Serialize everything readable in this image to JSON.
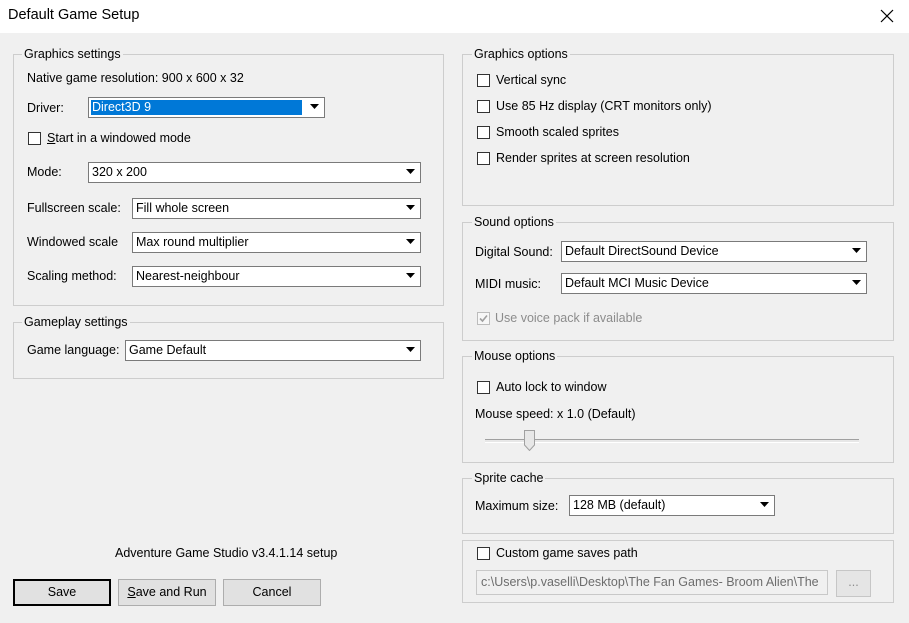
{
  "window": {
    "title": "Default Game Setup"
  },
  "graphics_settings": {
    "legend": "Graphics settings",
    "native_resolution": "Native game resolution: 900 x 600 x 32",
    "driver_label": "Driver:",
    "driver_value": "Direct3D 9",
    "windowed_label_s": "S",
    "windowed_label_rest": "tart in a windowed mode",
    "windowed_checked": false,
    "mode_label": "Mode:",
    "mode_value": "320 x 200",
    "fullscreen_scale_label": "Fullscreen scale:",
    "fullscreen_scale_value": "Fill whole screen",
    "windowed_scale_label": "Windowed scale",
    "windowed_scale_value": "Max round multiplier",
    "scaling_method_label": "Scaling method:",
    "scaling_method_value": "Nearest-neighbour"
  },
  "gameplay_settings": {
    "legend": "Gameplay settings",
    "language_label": "Game language:",
    "language_value": "Game Default"
  },
  "footer": {
    "version_text": "Adventure Game Studio v3.4.1.14 setup",
    "save_label": "Save",
    "save_run_prefix": "",
    "save_run_u": "S",
    "save_run_rest": "ave and Run",
    "cancel_label": "Cancel"
  },
  "graphics_options": {
    "legend": "Graphics options",
    "vsync_label": "Vertical sync",
    "hz85_label": "Use 85 Hz display (CRT monitors only)",
    "smooth_label": "Smooth scaled sprites",
    "render_label": "Render sprites at screen resolution"
  },
  "sound_options": {
    "legend": "Sound options",
    "digital_label": "Digital Sound:",
    "digital_value": "Default DirectSound Device",
    "midi_label": "MIDI music:",
    "midi_value": "Default MCI Music Device",
    "voice_label": "Use voice pack if available",
    "voice_checked": true
  },
  "mouse_options": {
    "legend": "Mouse options",
    "autolock_label": "Auto lock to window",
    "speed_label": "Mouse speed: x 1.0 (Default)",
    "speed_fraction": 0.12
  },
  "sprite_cache": {
    "legend": "Sprite cache",
    "max_label": "Maximum size:",
    "max_value": "128 MB (default)"
  },
  "custom_saves": {
    "label": "Custom game saves path",
    "path": "c:\\Users\\p.vaselli\\Desktop\\The Fan Games- Broom Alien\\The",
    "browse_label": "..."
  },
  "icons": {
    "close": "close-icon",
    "dropdown": "chevron-down-icon",
    "check": "checkmark-icon"
  }
}
